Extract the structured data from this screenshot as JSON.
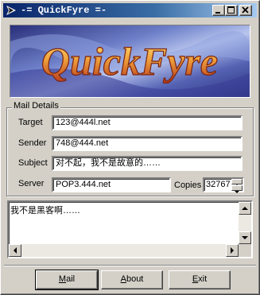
{
  "window": {
    "title": "-= QuickFyre =-",
    "controls": [
      "minimize-icon",
      "maximize-icon",
      "close-icon"
    ]
  },
  "banner": {
    "logo_text": "QuickFyre",
    "colors": {
      "flame_light": "#ffd45a",
      "flame_dark": "#c8461e",
      "bg_blue": "#3c46a0"
    }
  },
  "mail_details": {
    "legend": "Mail Details",
    "target": {
      "label": "Target",
      "value": "123@444l.net"
    },
    "sender": {
      "label": "Sender",
      "value": "748@444.net"
    },
    "subject": {
      "label": "Subject",
      "value": "对不起，我不是故意的……"
    },
    "server": {
      "label": "Server",
      "value": "POP3.444.net"
    },
    "copies": {
      "label": "Copies",
      "value": "32767"
    }
  },
  "message": {
    "body": "我不是黑客啊……"
  },
  "buttons": {
    "mail": {
      "label_first": "M",
      "label_rest": "ail"
    },
    "about": {
      "label_first": "A",
      "label_rest": "bout"
    },
    "exit": {
      "label_first": "E",
      "label_rest": "xit"
    }
  }
}
